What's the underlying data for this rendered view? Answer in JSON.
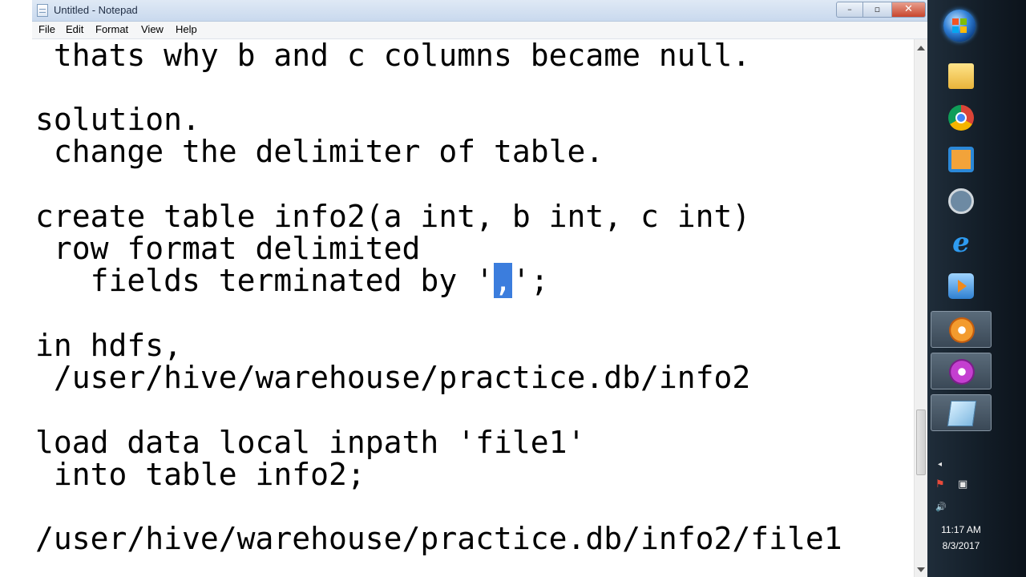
{
  "window": {
    "title": "Untitled - Notepad",
    "controls": {
      "minimize": "–",
      "maximize": "▫",
      "close": "✕"
    }
  },
  "menu": [
    "File",
    "Edit",
    "Format",
    "View",
    "Help"
  ],
  "editor": {
    "lines": [
      " thats why b and c columns became null.",
      "",
      "solution.",
      " change the delimiter of table.",
      "",
      "create table info2(a int, b int, c int)",
      " row format delimited",
      "   fields terminated by '",
      "",
      "in hdfs,",
      " /user/hive/warehouse/practice.db/info2",
      "",
      "load data local inpath 'file1'",
      " into table info2;",
      "",
      "/user/hive/warehouse/practice.db/info2/file1"
    ],
    "selected_text": ",",
    "after_selection": "';"
  },
  "taskbar": {
    "apps": [
      {
        "name": "folder-icon"
      },
      {
        "name": "chrome-icon"
      },
      {
        "name": "vm-icon"
      },
      {
        "name": "search-icon"
      },
      {
        "name": "ie-icon",
        "glyph": "e"
      },
      {
        "name": "media-icon"
      },
      {
        "name": "flower-orange-icon"
      },
      {
        "name": "flower-purple-icon"
      },
      {
        "name": "notepad-icon"
      }
    ],
    "tray": {
      "chevron": "◂",
      "flag": "⚑",
      "network": "▣",
      "volume": "🔊"
    },
    "clock": {
      "time": "11:17 AM",
      "date": "8/3/2017"
    }
  }
}
